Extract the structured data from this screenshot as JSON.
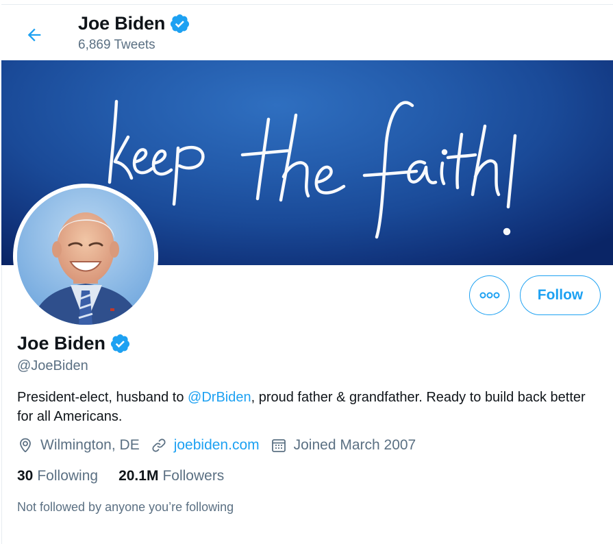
{
  "header": {
    "name": "Joe Biden",
    "tweet_count": "6,869 Tweets"
  },
  "banner": {
    "text": "keep the faith!"
  },
  "actions": {
    "follow_label": "Follow"
  },
  "profile": {
    "name": "Joe Biden",
    "handle": "@JoeBiden",
    "bio_before": "President-elect, husband to ",
    "bio_mention": "@DrBiden",
    "bio_after": ", proud father & grandfather. Ready to build back better for all Americans.",
    "location": "Wilmington, DE",
    "website": "joebiden.com",
    "joined": "Joined March 2007"
  },
  "stats": {
    "following_count": "30",
    "following_label": "Following",
    "followers_count": "20.1M",
    "followers_label": "Followers"
  },
  "social_context": "Not followed by anyone you’re following",
  "colors": {
    "accent": "#1da1f2",
    "secondary_text": "#5b7083",
    "primary_text": "#0f1419",
    "banner_blue": "#235bab"
  },
  "icons": [
    "back-arrow-icon",
    "verified-badge-icon",
    "more-options-icon",
    "location-icon",
    "link-icon",
    "calendar-icon"
  ]
}
